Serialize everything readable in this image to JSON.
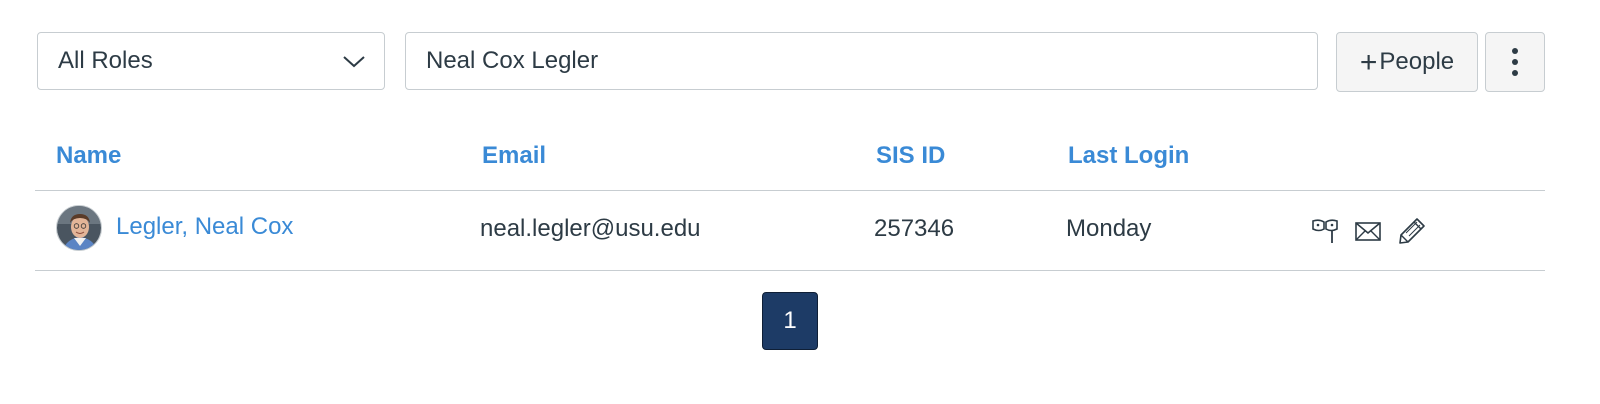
{
  "filters": {
    "role_select_value": "All Roles",
    "search_value": "Neal Cox Legler"
  },
  "toolbar": {
    "add_people_label": "People",
    "add_people_icon": "plus-icon",
    "more_options_icon": "more-vertical-icon"
  },
  "table": {
    "columns": [
      "Name",
      "Email",
      "SIS ID",
      "Last Login"
    ],
    "rows": [
      {
        "name": "Legler, Neal Cox",
        "email": "neal.legler@usu.edu",
        "sis_id": "257346",
        "last_login": "Monday",
        "actions": [
          "masquerade-icon",
          "message-icon",
          "edit-icon"
        ]
      }
    ]
  },
  "pagination": {
    "current_page": "1"
  },
  "colors": {
    "link": "#3a8ad6",
    "text": "#2d3b45",
    "border": "#c7cdd1",
    "active_page": "#1d3b66"
  }
}
